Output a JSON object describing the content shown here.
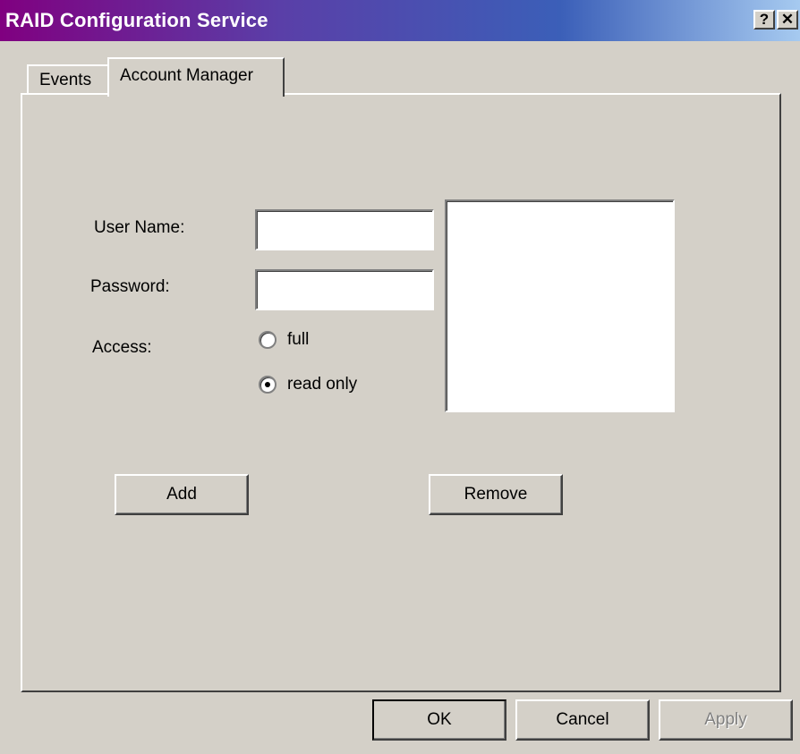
{
  "window": {
    "title": "RAID Configuration Service",
    "help_glyph": "?",
    "close_glyph": "✕"
  },
  "tabs": [
    {
      "label": "Events",
      "selected": false
    },
    {
      "label": "Account Manager",
      "selected": true
    }
  ],
  "form": {
    "user_name_label": "User Name:",
    "user_name_value": "",
    "password_label": "Password:",
    "password_value": "",
    "access_label": "Access:",
    "access_options": [
      {
        "label": "full",
        "checked": false
      },
      {
        "label": "read only",
        "checked": true
      }
    ],
    "accounts_list": []
  },
  "actions": {
    "add_label": "Add",
    "remove_label": "Remove"
  },
  "footer": {
    "ok_label": "OK",
    "cancel_label": "Cancel",
    "apply_label": "Apply",
    "apply_enabled": false
  },
  "colors": {
    "title_gradient_start": "#800080",
    "title_gradient_end": "#a6caf0",
    "face": "#d4d0c8"
  },
  "icons": [
    "help-icon",
    "close-icon"
  ]
}
